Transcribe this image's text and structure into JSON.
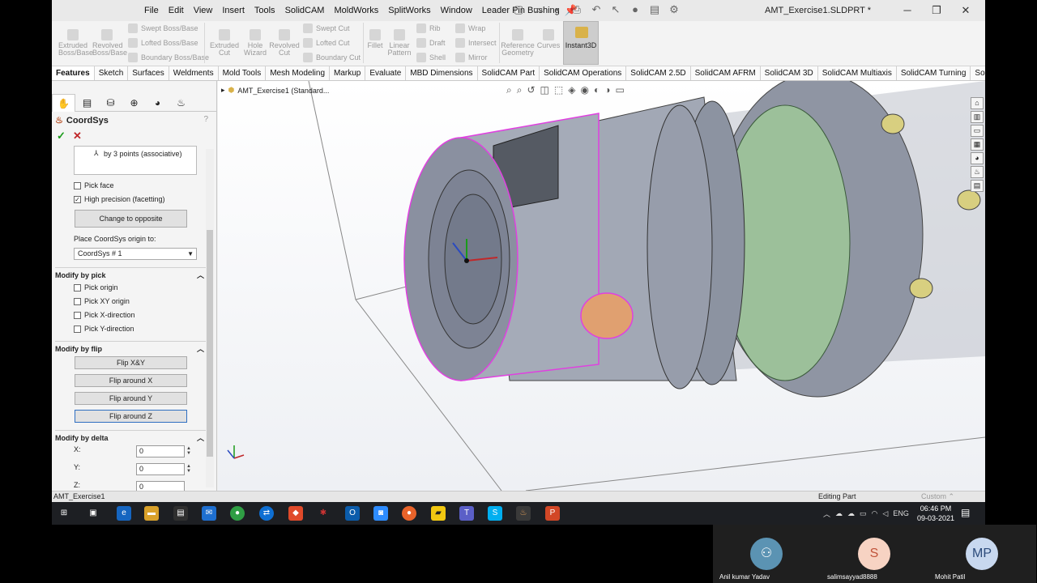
{
  "menu": [
    "File",
    "Edit",
    "View",
    "Insert",
    "Tools",
    "SolidCAM",
    "MoldWorks",
    "SplitWorks",
    "Window",
    "Leader Pin Bushing"
  ],
  "document_title": "AMT_Exercise1.SLDPRT *",
  "ribbon": {
    "extruded_boss": "Extruded Boss/Base",
    "revolved_boss": "Revolved Boss/Base",
    "swept_boss": "Swept Boss/Base",
    "lofted_boss": "Lofted Boss/Base",
    "boundary_boss": "Boundary Boss/Base",
    "extruded_cut": "Extruded Cut",
    "hole_wizard": "Hole Wizard",
    "revolved_cut": "Revolved Cut",
    "swept_cut": "Swept Cut",
    "lofted_cut": "Lofted Cut",
    "boundary_cut": "Boundary Cut",
    "fillet": "Fillet",
    "linear_pattern": "Linear Pattern",
    "rib": "Rib",
    "draft": "Draft",
    "shell": "Shell",
    "wrap": "Wrap",
    "intersect": "Intersect",
    "mirror": "Mirror",
    "reference_geometry": "Reference Geometry",
    "curves": "Curves",
    "instant3d": "Instant3D"
  },
  "tabs": [
    "Features",
    "Sketch",
    "Surfaces",
    "Weldments",
    "Mold Tools",
    "Mesh Modeling",
    "Markup",
    "Evaluate",
    "MBD Dimensions",
    "SolidCAM Part",
    "SolidCAM Operations",
    "SolidCAM 2.5D",
    "SolidCAM AFRM",
    "SolidCAM 3D",
    "SolidCAM Multiaxis",
    "SolidCAM Turning",
    "SolidCAM Templates"
  ],
  "panel": {
    "title": "CoordSys",
    "help": "?",
    "define_mode": "by 3 points (associative)",
    "pick_face": "Pick face",
    "high_precision": "High precision (facetting)",
    "change_opposite": "Change to opposite",
    "place_origin_label": "Place CoordSys origin to:",
    "origin_value": "CoordSys # 1",
    "modify_by_pick": "Modify by pick",
    "pick_origin": "Pick origin",
    "pick_xy_origin": "Pick XY origin",
    "pick_x_direction": "Pick X-direction",
    "pick_y_direction": "Pick Y-direction",
    "modify_by_flip": "Modify by flip",
    "flip_xy": "Flip  X&Y",
    "flip_x": "Flip around X",
    "flip_y": "Flip around Y",
    "flip_z": "Flip around Z",
    "modify_by_delta": "Modify by delta",
    "x_label": "X:",
    "y_label": "Y:",
    "z_label": "Z:",
    "x_value": "0",
    "y_value": "0",
    "z_value": "0"
  },
  "viewport": {
    "tree_node": "AMT_Exercise1  (Standard..."
  },
  "status": {
    "left": "AMT_Exercise1",
    "mode": "Editing Part",
    "units": "Custom"
  },
  "taskbar": {
    "language": "ENG",
    "time": "06:46 PM",
    "date": "09-03-2021"
  },
  "participants": [
    {
      "name": "Anil kumar Yadav",
      "initials": "",
      "color": "#5b93b3"
    },
    {
      "name": "salimsayyad8888",
      "initials": "S",
      "color": "#f7d3c3"
    },
    {
      "name": "Mohit Patil",
      "initials": "MP",
      "color": "#c8d8ef"
    }
  ],
  "colors": {
    "selection_edge": "#e040e0",
    "part_body": "#9aa1b0",
    "green_band": "#9cc09a",
    "highlight_face": "#e0a070"
  }
}
